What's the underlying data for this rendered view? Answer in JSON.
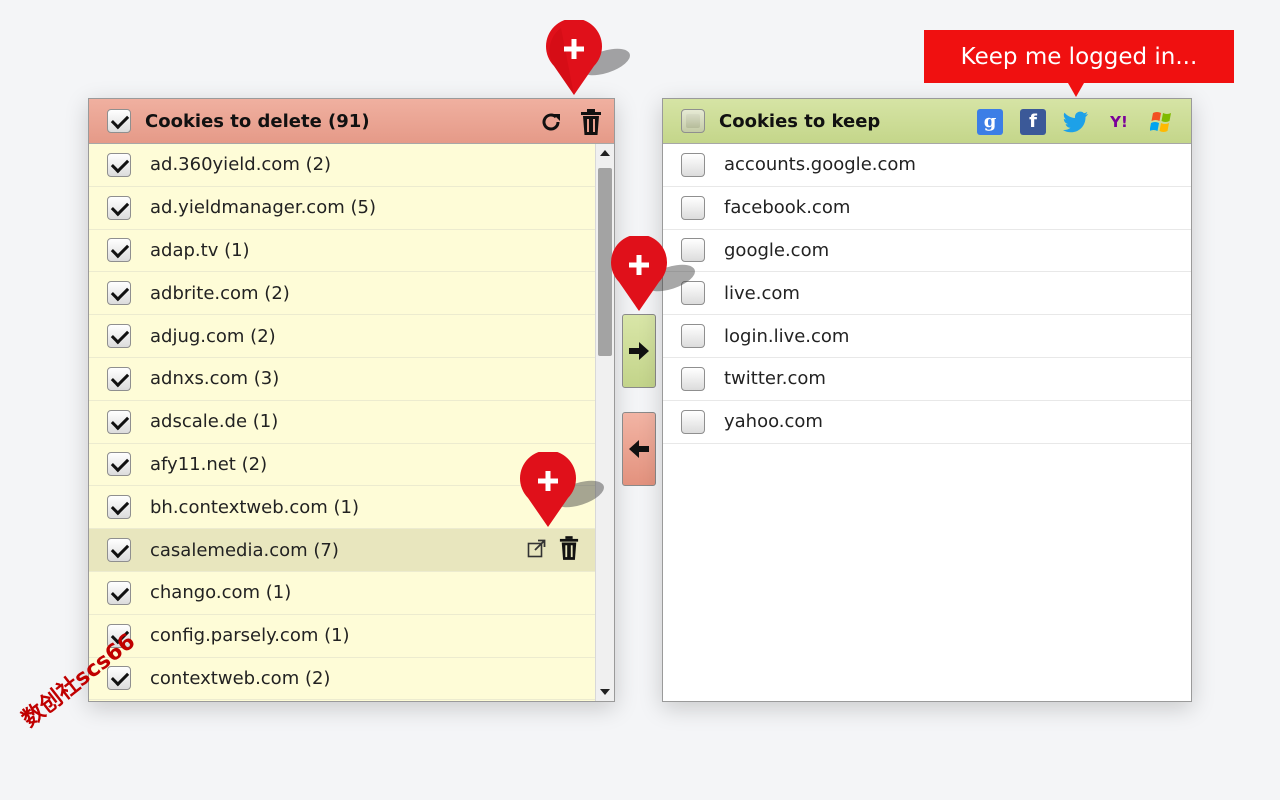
{
  "delete_panel": {
    "title": "Cookies to delete (91)",
    "items": [
      {
        "label": "ad.360yield.com (2)"
      },
      {
        "label": "ad.yieldmanager.com (5)"
      },
      {
        "label": "adap.tv (1)"
      },
      {
        "label": "adbrite.com (2)"
      },
      {
        "label": "adjug.com (2)"
      },
      {
        "label": "adnxs.com (3)"
      },
      {
        "label": "adscale.de (1)"
      },
      {
        "label": "afy11.net (2)"
      },
      {
        "label": "bh.contextweb.com (1)"
      },
      {
        "label": "casalemedia.com (7)"
      },
      {
        "label": "chango.com (1)"
      },
      {
        "label": "config.parsely.com (1)"
      },
      {
        "label": "contextweb.com (2)"
      }
    ]
  },
  "keep_panel": {
    "title": "Cookies to keep",
    "social_icons": [
      "google-icon",
      "facebook-icon",
      "twitter-icon",
      "yahoo-icon",
      "windows-icon"
    ],
    "items": [
      {
        "label": "accounts.google.com"
      },
      {
        "label": "facebook.com"
      },
      {
        "label": "google.com"
      },
      {
        "label": "live.com"
      },
      {
        "label": "login.live.com"
      },
      {
        "label": "twitter.com"
      },
      {
        "label": "yahoo.com"
      }
    ]
  },
  "callout": {
    "text": "Keep me logged in..."
  },
  "watermark": {
    "text": "数创社scs66"
  },
  "colors": {
    "delete_header": "#e59a88",
    "keep_header": "#c4d68a",
    "delete_bg": "#fefcd7",
    "callout_bg": "#f01010",
    "pin": "#e0101a"
  }
}
